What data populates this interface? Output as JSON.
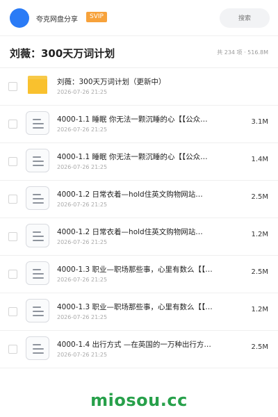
{
  "header": {
    "brand": "夸克网盘分享",
    "badge": "SVIP",
    "search_placeholder": "搜索",
    "accent_color": "#2a7bf6"
  },
  "folder": {
    "title": "刘薇：300天万词计划",
    "summary": "共 234 项 · 516.8M"
  },
  "items": [
    {
      "type": "folder",
      "icon": "folder-icon",
      "name": "刘薇：300天万词计划（更新中）",
      "date": "2026-07-26 21:25",
      "size": ""
    },
    {
      "type": "file",
      "icon": "file-icon",
      "name": "4000-1.1 睡眠 你无法一颗沉睡的心【【公众…",
      "date": "2026-07-26 21:25",
      "size": "3.1M"
    },
    {
      "type": "file",
      "icon": "file-icon",
      "name": "4000-1.1 睡眠 你无法一颗沉睡的心【【公众…",
      "date": "2026-07-26 21:25",
      "size": "1.4M"
    },
    {
      "type": "file",
      "icon": "file-icon",
      "name": "4000-1.2 日常衣着—hold住英文购物网站…",
      "date": "2026-07-26 21:25",
      "size": "2.5M"
    },
    {
      "type": "file",
      "icon": "file-icon",
      "name": "4000-1.2 日常衣着—hold住英文购物网站…",
      "date": "2026-07-26 21:25",
      "size": "1.2M"
    },
    {
      "type": "file",
      "icon": "file-icon",
      "name": "4000-1.3 职业—职场那些事，心里有数么【【…",
      "date": "2026-07-26 21:25",
      "size": "2.5M"
    },
    {
      "type": "file",
      "icon": "file-icon",
      "name": "4000-1.3 职业—职场那些事，心里有数么【【…",
      "date": "2026-07-26 21:25",
      "size": "1.2M"
    },
    {
      "type": "file",
      "icon": "file-icon",
      "name": "4000-1.4 出行方式 —在英国的一万种出行方…",
      "date": "2026-07-26 21:25",
      "size": "2.5M"
    }
  ],
  "watermark": "miosou.cc"
}
